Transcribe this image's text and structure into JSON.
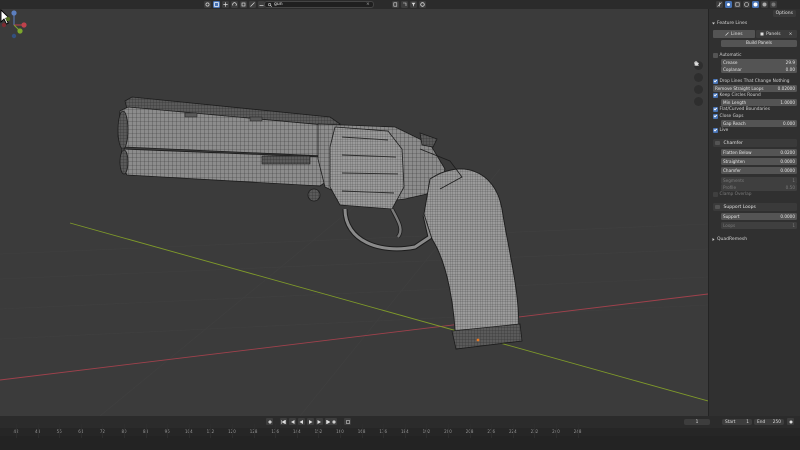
{
  "header": {
    "transform_orientation": "Global",
    "search_value": "gun",
    "options_label": "Options"
  },
  "panel": {
    "title": "Feature Lines",
    "tabs": [
      {
        "label": "Lines"
      },
      {
        "label": "Panels"
      }
    ],
    "build_button": "Build Panels",
    "rows": {
      "automatic": "Automatic",
      "crease": {
        "label": "Crease",
        "value": "29.9"
      },
      "coplanar": {
        "label": "Coplanar",
        "value": "0.00"
      },
      "drop_lines": "Drop Lines That Change Nothing",
      "remove_straight": {
        "label": "Remove Straight Loops",
        "value": "0.02000"
      },
      "keep_circles": "Keep Circles Round",
      "min_length": {
        "label": "Min Length",
        "value": "1.0000"
      },
      "flat_curved": "Flat/Curved Boundaries",
      "close_gaps": "Close Gaps",
      "gap_reach": {
        "label": "Gap Reach",
        "value": "0.000"
      },
      "live": "Live"
    },
    "chamfer": {
      "title": "Chamfer",
      "flatten_below": {
        "label": "Flatten Below",
        "value": "0.0200"
      },
      "straighten": {
        "label": "Straighten",
        "value": "0.0000"
      },
      "chamfer": {
        "label": "Chamfer",
        "value": "0.0000"
      },
      "segments": {
        "label": "Segments",
        "value": "1"
      },
      "profile": {
        "label": "Profile",
        "value": "0.50"
      },
      "clamp_overlap": "Clamp Overlap"
    },
    "support": {
      "title": "Support Loops",
      "support": {
        "label": "Support",
        "value": "0.0000"
      },
      "loops": {
        "label": "Loops",
        "value": "1"
      }
    },
    "quadremesh": "QuadRemesh"
  },
  "timeline": {
    "current_frame": "1",
    "start_label": "Start",
    "start_value": "1",
    "end_label": "End",
    "end_value": "250",
    "ruler": [
      "42",
      "48",
      "56",
      "64",
      "72",
      "80",
      "88",
      "96",
      "104",
      "112",
      "120",
      "128",
      "136",
      "144",
      "152",
      "160",
      "168",
      "176",
      "184",
      "192",
      "200",
      "208",
      "216",
      "224",
      "232",
      "240",
      "248"
    ]
  },
  "colors": {
    "viewport_bg": "#3b3b3b",
    "accent": "#4772b3",
    "axis_x": "#b0434f",
    "axis_y": "#7f9a2a"
  }
}
